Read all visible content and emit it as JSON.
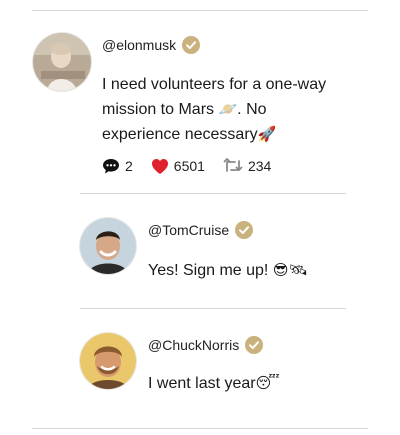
{
  "thread": {
    "post": {
      "handle": "@elonmusk",
      "verified": true,
      "text_line1": "I need volunteers for a one-way",
      "text_line2": "mission to Mars",
      "text_line2_emoji": "🪐",
      "text_line2_end": ". No",
      "text_line3": "experience necessary",
      "text_line3_emoji": "🚀",
      "counts": {
        "comments": "2",
        "likes": "6501",
        "retweets": "234"
      }
    },
    "replies": [
      {
        "handle": "@TomCruise",
        "verified": true,
        "text": "Yes! Sign me up! ",
        "emoji": "😎🛰"
      },
      {
        "handle": "@ChuckNorris",
        "verified": true,
        "text": "I went last year",
        "emoji": "😴"
      }
    ]
  },
  "colors": {
    "verified": "#c9b27d",
    "heart": "#e0202c",
    "divider": "#d6d6d6"
  },
  "icons": [
    "avatar-child-photo",
    "avatar-man-smiling",
    "avatar-man-grinning",
    "verified-icon",
    "comment-icon",
    "heart-icon",
    "retweet-icon"
  ]
}
